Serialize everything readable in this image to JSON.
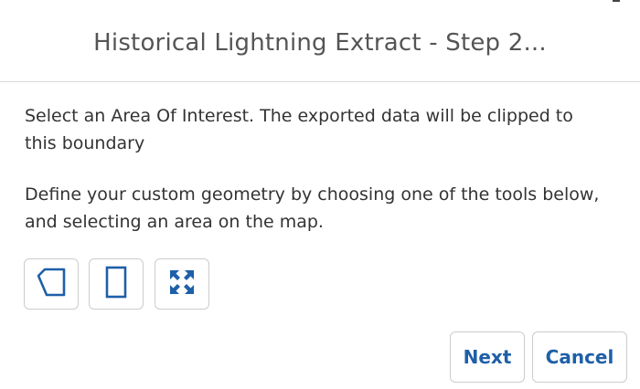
{
  "dialog": {
    "title": "Historical Lightning Extract - Step 2..."
  },
  "body": {
    "instruction_aoi": "Select an Area Of Interest. The exported data will be clipped to this boundary",
    "instruction_tools": "Define your custom geometry by choosing one of the tools below, and selecting an area on the map."
  },
  "tools": [
    {
      "icon": "polygon-icon"
    },
    {
      "icon": "rectangle-icon"
    },
    {
      "icon": "full-extent-icon"
    }
  ],
  "footer": {
    "next_label": "Next",
    "cancel_label": "Cancel"
  },
  "colors": {
    "accent": "#1f5fa8",
    "border": "#cccccc",
    "title_text": "#555555",
    "body_text": "#333333"
  }
}
